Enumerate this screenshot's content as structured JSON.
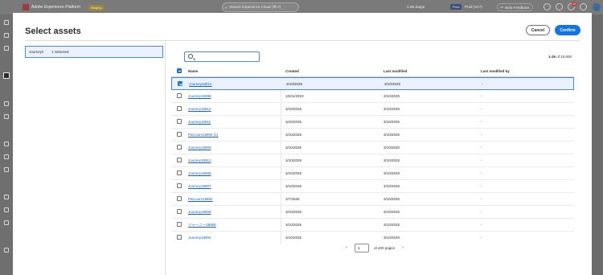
{
  "topbar": {
    "product": "Adobe Experience Platform",
    "env_badge": "Staging",
    "search_placeholder": "Search Experience Cloud (⌘+/)",
    "sandbox_label": "CJM Stage",
    "prod_badge": "Prod",
    "prod_name": "Prod (VA7)",
    "beta_feedback": "Beta Feedback",
    "notification_count": "10"
  },
  "modal": {
    "title": "Select assets",
    "cancel_label": "Cancel",
    "confirm_label": "Confirm",
    "selection": {
      "type": "Journeys",
      "count_label": "1 Selected"
    },
    "search": {
      "value": "",
      "placeholder": ""
    },
    "range": {
      "bold": "1-25",
      "rest": " of 10,000"
    },
    "table": {
      "headers": {
        "name": "Name",
        "created": "Created",
        "last_modified": "Last modified",
        "last_modified_by": "Last modified by"
      },
      "rows": [
        {
          "name": "Journey18914",
          "created": "3/10/2025",
          "modified": "3/10/2025",
          "modby": "-",
          "checked": true
        },
        {
          "name": "Journey15598",
          "created": "10/31/2023",
          "modified": "3/10/2025",
          "modby": "-",
          "checked": false
        },
        {
          "name": "Journey18912",
          "created": "3/10/2025",
          "modified": "3/10/2025",
          "modby": "-",
          "checked": false
        },
        {
          "name": "Journey18911",
          "created": "3/10/2025",
          "modified": "3/10/2025",
          "modby": "-",
          "checked": false
        },
        {
          "name": "Parcours18894 (1)",
          "created": "3/10/2025",
          "modified": "3/10/2025",
          "modby": "-",
          "checked": false
        },
        {
          "name": "Journey18909",
          "created": "3/10/2025",
          "modified": "3/10/2025",
          "modby": "-",
          "checked": false
        },
        {
          "name": "Journey18910",
          "created": "3/10/2025",
          "modified": "3/10/2025",
          "modby": "-",
          "checked": false
        },
        {
          "name": "Journey18908",
          "created": "3/10/2025",
          "modified": "3/10/2025",
          "modby": "-",
          "checked": false
        },
        {
          "name": "Journey18907",
          "created": "3/10/2025",
          "modified": "3/10/2025",
          "modby": "-",
          "checked": false
        },
        {
          "name": "Parcours18882",
          "created": "3/7/2025",
          "modified": "3/10/2025",
          "modby": "-",
          "checked": false
        },
        {
          "name": "Journey18906",
          "created": "3/10/2025",
          "modified": "3/10/2025",
          "modby": "-",
          "checked": false
        },
        {
          "name": "ジャーニー18905",
          "created": "3/10/2025",
          "modified": "3/10/2025",
          "modby": "-",
          "checked": false
        },
        {
          "name": "Journey18904",
          "created": "3/10/2025",
          "modified": "3/10/2025",
          "modby": "-",
          "checked": false
        }
      ]
    },
    "pager": {
      "page": "1",
      "of_label": "of 400 pages"
    }
  },
  "colors": {
    "accent": "#1473e6",
    "link": "#1463c7",
    "selected_bg": "#eaf1fb"
  }
}
